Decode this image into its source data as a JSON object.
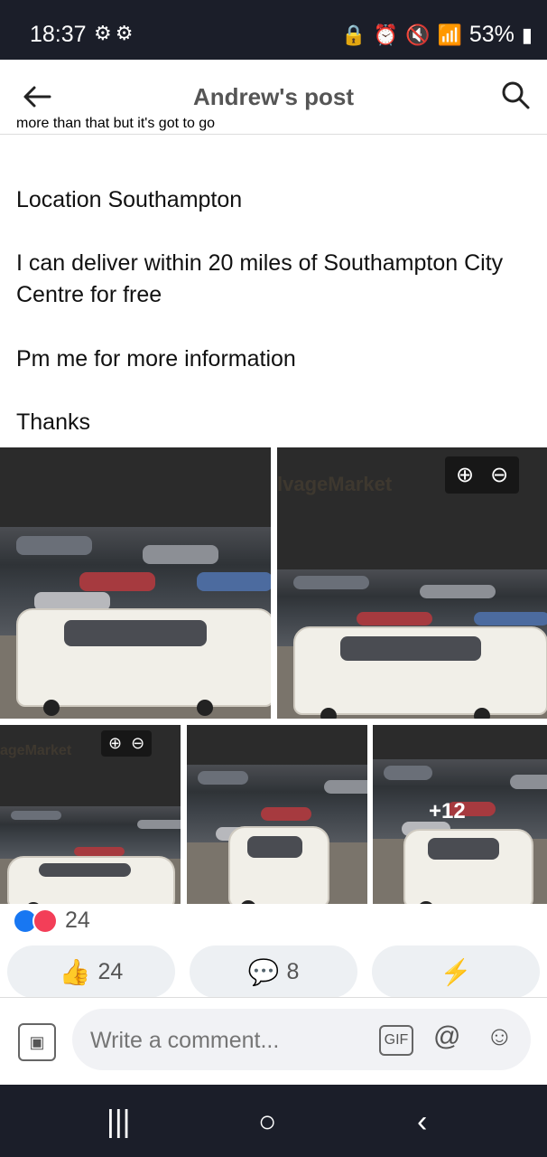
{
  "status": {
    "time": "18:37",
    "battery": "53%",
    "notification_icons": [
      "settings-gear-icon",
      "settings-gear-icon"
    ],
    "system_icons": [
      "lock-icon",
      "alarm-icon",
      "mute-icon",
      "wifi-icon",
      "signal-icon",
      "battery-icon"
    ]
  },
  "header": {
    "title": "Andrew's post",
    "back_icon": "back-arrow-icon",
    "search_icon": "search-icon"
  },
  "post": {
    "cut_text": "more than that but it's got to go",
    "paragraphs": [
      "Location Southampton",
      "I can deliver within 20 miles of Southampton City Centre for free",
      "Pm me for more information",
      "Thanks"
    ]
  },
  "media": {
    "watermark_1": "lvageMarket",
    "watermark_2": "ageMarket",
    "more_count": "+12",
    "zoom_in": "⊕",
    "zoom_out": "⊖"
  },
  "reactions": {
    "count": "24"
  },
  "actions": {
    "like_count": "24",
    "comment_count": "8",
    "like_icon": "thumbs-up-icon",
    "comment_icon": "comment-bubble-icon",
    "share_icon": "messenger-icon"
  },
  "composer": {
    "placeholder": "Write a comment...",
    "gif_label": "GIF",
    "mention_label": "@",
    "emoji_label": "☺"
  },
  "navigation": {
    "recents_label": "|||",
    "home_label": "○",
    "back_label": "‹"
  },
  "colors": {
    "facebook_blue": "#1877f2",
    "love_red": "#f33e58",
    "status_bar": "#1b1e29",
    "button_gray": "#edf0f3"
  }
}
